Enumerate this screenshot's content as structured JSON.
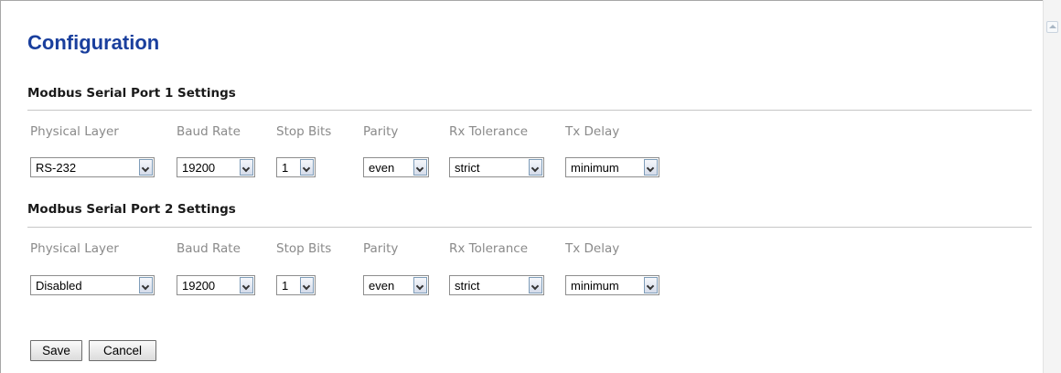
{
  "page": {
    "title": "Configuration"
  },
  "columns": [
    "Physical Layer",
    "Baud Rate",
    "Stop Bits",
    "Parity",
    "Rx Tolerance",
    "Tx Delay"
  ],
  "port1": {
    "title": "Modbus Serial Port 1 Settings",
    "physical_layer": "RS-232",
    "baud_rate": "19200",
    "stop_bits": "1",
    "parity": "even",
    "rx_tolerance": "strict",
    "tx_delay": "minimum"
  },
  "port2": {
    "title": "Modbus Serial Port 2 Settings",
    "physical_layer": "Disabled",
    "baud_rate": "19200",
    "stop_bits": "1",
    "parity": "even",
    "rx_tolerance": "strict",
    "tx_delay": "minimum"
  },
  "buttons": {
    "save": "Save",
    "cancel": "Cancel"
  },
  "icons": {
    "scroll_up": "scroll-up-arrow-icon",
    "dropdown": "chevron-down-icon"
  },
  "colors": {
    "title": "#1a3f9d",
    "label": "#8a8a8a"
  }
}
